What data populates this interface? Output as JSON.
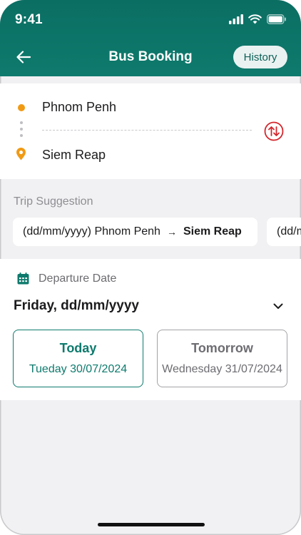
{
  "status_bar": {
    "time": "9:41"
  },
  "nav": {
    "title": "Bus Booking",
    "history_label": "History"
  },
  "route": {
    "origin": "Phnom Penh",
    "destination": "Siem Reap"
  },
  "suggestions": {
    "title": "Trip Suggestion",
    "items": [
      {
        "date": "(dd/mm/yyyy) Phnom Penh",
        "arrow": "→",
        "to": "Siem Reap"
      },
      {
        "date": "(dd/mm/yyyy) Siem Reap"
      }
    ]
  },
  "departure": {
    "label": "Departure Date",
    "value": "Friday, dd/mm/yyyy",
    "today": {
      "name": "Today",
      "date": "Tueday 30/07/2024"
    },
    "tomorrow": {
      "name": "Tomorrow",
      "date": "Wednesday 31/07/2024"
    }
  },
  "colors": {
    "brand": "#0e7a6d",
    "accent": "#f09a14",
    "swap": "#d3262c"
  }
}
